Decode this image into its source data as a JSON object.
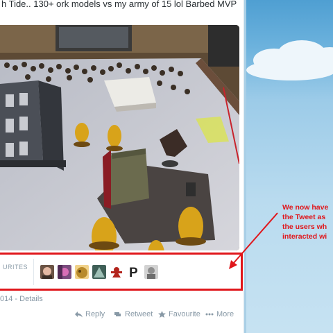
{
  "tweet": {
    "text": "h Tide.. 130+ ork models vs my army of 15 lol Barbed MVP"
  },
  "favourites": {
    "label": "URITES",
    "avatars": [
      {
        "name": "avatar-1",
        "color": "#6b5344"
      },
      {
        "name": "avatar-2",
        "color": "#7a4c7e"
      },
      {
        "name": "avatar-3",
        "color": "#b88a2a"
      },
      {
        "name": "avatar-4",
        "color": "#3f5f57"
      },
      {
        "name": "avatar-5",
        "color": "#b3241c"
      },
      {
        "name": "avatar-6",
        "color": "#222222"
      },
      {
        "name": "avatar-7",
        "color": "#8e8e8e"
      }
    ]
  },
  "meta": {
    "date": "014",
    "separator": " - ",
    "details": "Details"
  },
  "actions": {
    "reply": "Reply",
    "retweet": "Retweet",
    "favourite": "Favourite",
    "more": "More"
  },
  "annotation": {
    "line1": "We now have",
    "line2": "the Tweet as",
    "line3": "the users wh",
    "line4": "interacted wi",
    "color": "#e0161b"
  }
}
